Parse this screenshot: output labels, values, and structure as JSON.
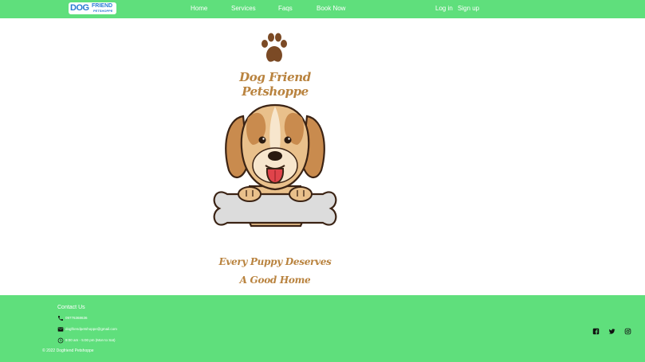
{
  "navbar": {
    "logo": {
      "dog": "DOG",
      "friend": "FRIEND",
      "shop": "PETSHOPPE"
    },
    "links": {
      "home": "Home",
      "services": "Services",
      "faqs": "Faqs",
      "book_now": "Book Now"
    },
    "auth": {
      "login": "Log in",
      "signup": "Sign up"
    }
  },
  "hero": {
    "brand_title": "Dog Friend Petshoppe",
    "tagline_line1": "Every Puppy Deserves",
    "tagline_line2": "A Good Home"
  },
  "footer": {
    "contact_title": "Contact Us",
    "phone": "09776368636",
    "email": "dogfriendpetshoppe@gmail.com",
    "hours": "9:00 am - 5:00 pm (Mon to Sat)",
    "copyright": "© 2022 Dogfriend Petshoppe",
    "social": [
      "facebook-icon",
      "twitter-icon",
      "instagram-icon"
    ]
  },
  "colors": {
    "brand_green": "#5fdf7c",
    "brown": "#b9833f",
    "dark_brown": "#7b4a25"
  }
}
